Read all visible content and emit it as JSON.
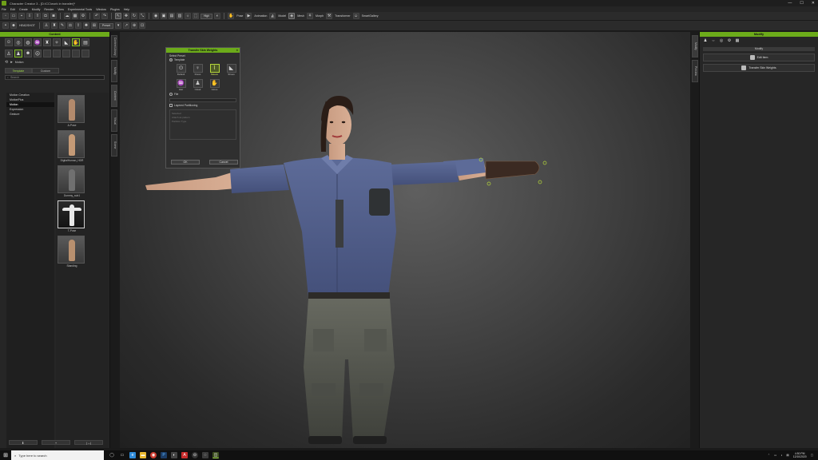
{
  "window": {
    "title": "Character Creator 3 - [D:\\CC\\work in transfer]*",
    "controls": [
      "—",
      "☐",
      "✕"
    ]
  },
  "menu": [
    "File",
    "Edit",
    "Create",
    "Modify",
    "Render",
    "View",
    "Experimental Tools",
    "Window",
    "Plugins",
    "Help"
  ],
  "toolbar1": {
    "quality": "High",
    "items": [
      "Pose",
      "Animation",
      "Model",
      "Mesh",
      "Transformer",
      "Face",
      "Morph"
    ],
    "smartgallery": "SmartGallery"
  },
  "toolbar2": {
    "headshot": "HEADSHOT",
    "preset": "Preset"
  },
  "content_panel": {
    "title": "Content",
    "breadcrumb": "Motion",
    "tabs": [
      "Template",
      "Custom"
    ],
    "search_placeholder": "Search",
    "tree": [
      "Motion Creation",
      "MotionPlus",
      "Motion",
      "Expression",
      "Gesture"
    ],
    "thumbs": [
      "A-Pose",
      "DigitalHuman_HDR",
      "Dummy_sub1",
      "T-Pose",
      "Standing"
    ],
    "bottom_buttons": [
      "⬇",
      "+",
      "|↔|"
    ]
  },
  "left_vtabs": [
    "Content Library",
    "Modify",
    "Content",
    "Visual",
    "Scene"
  ],
  "right_vtabs": [
    "Modify",
    "Preview"
  ],
  "dialog": {
    "title": "Transfer Skin Weights",
    "section": "Select Preset",
    "template_label": "Template",
    "templates": [
      "Default",
      "Dress",
      "Sleeve",
      "Shoes",
      "Hair",
      "Cloak",
      "Glove"
    ],
    "selected_template": "Sleeve",
    "file_label": "File",
    "layered_label": "Layered Partitioning",
    "layered_lines": [
      "Selected",
      "Attach as pattern",
      "Partition Type"
    ],
    "buttons": [
      "OK",
      "Cancel"
    ]
  },
  "modify_panel": {
    "title": "Modify",
    "sub": "Modify",
    "buttons": [
      "Edit Item",
      "Transfer Skin Weights"
    ]
  },
  "taskbar": {
    "search_placeholder": "Type here to search",
    "time": "4:50 PM",
    "date": "12/10/2020"
  },
  "colors": {
    "accent": "#6cab1a",
    "selected_template": "#b6d83a"
  }
}
